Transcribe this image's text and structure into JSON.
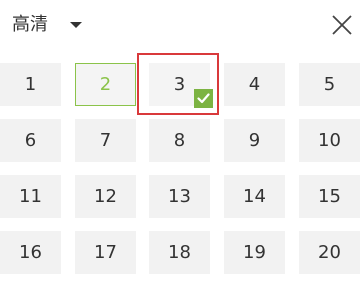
{
  "header": {
    "quality_label": "高清",
    "dropdown_icon": "caret-down-icon",
    "close_icon": "close-icon"
  },
  "episodes": [
    {
      "label": "1",
      "state": "normal"
    },
    {
      "label": "2",
      "state": "active"
    },
    {
      "label": "3",
      "state": "current"
    },
    {
      "label": "4",
      "state": "normal"
    },
    {
      "label": "5",
      "state": "normal"
    },
    {
      "label": "6",
      "state": "normal"
    },
    {
      "label": "7",
      "state": "normal"
    },
    {
      "label": "8",
      "state": "normal"
    },
    {
      "label": "9",
      "state": "normal"
    },
    {
      "label": "10",
      "state": "normal"
    },
    {
      "label": "11",
      "state": "normal"
    },
    {
      "label": "12",
      "state": "normal"
    },
    {
      "label": "13",
      "state": "normal"
    },
    {
      "label": "14",
      "state": "normal"
    },
    {
      "label": "15",
      "state": "normal"
    },
    {
      "label": "16",
      "state": "normal"
    },
    {
      "label": "17",
      "state": "normal"
    },
    {
      "label": "18",
      "state": "normal"
    },
    {
      "label": "19",
      "state": "normal"
    },
    {
      "label": "20",
      "state": "normal"
    }
  ],
  "current_indicator": {
    "icon": "checkmark-icon"
  },
  "colors": {
    "accent_green": "#8bc34a",
    "check_green": "#7cb342",
    "highlight_red": "#d9393b",
    "tile_bg": "#f2f2f2",
    "text": "#333333"
  }
}
